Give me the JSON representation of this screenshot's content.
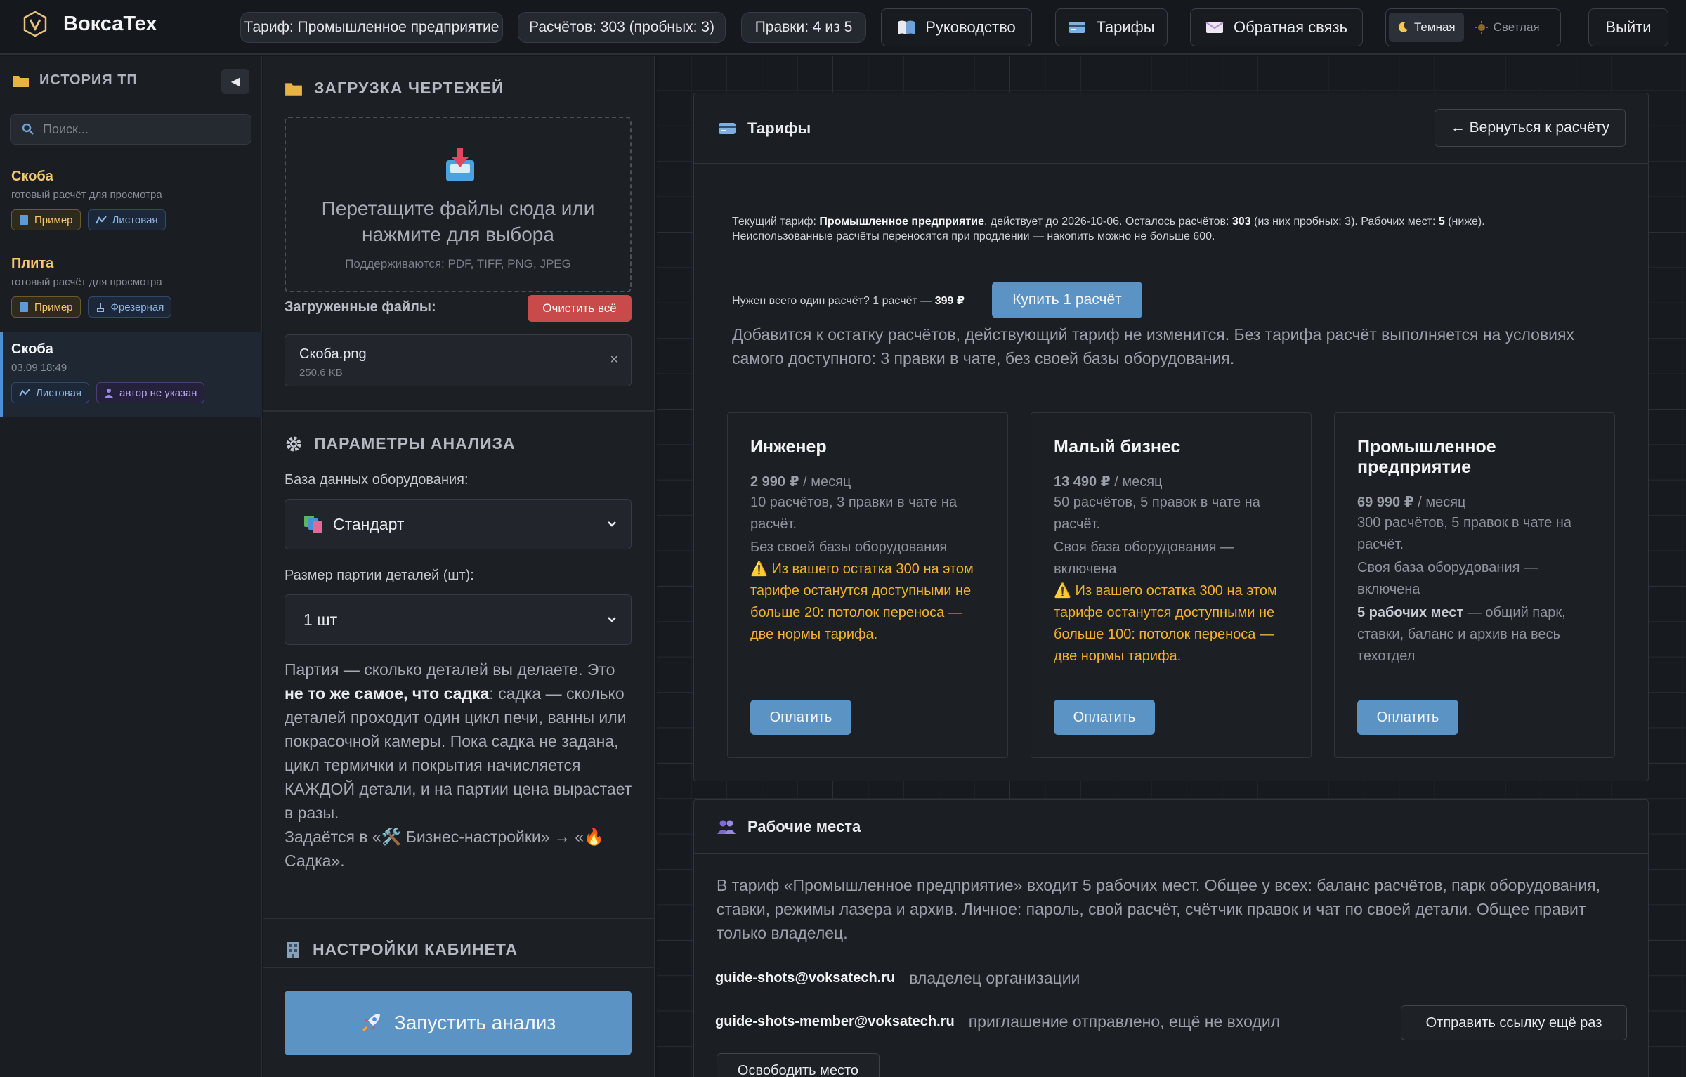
{
  "app": {
    "name": "ВоксаТех"
  },
  "topbar": {
    "tariff_pill": "Тариф: Промышленное предприятие",
    "calcs_pill": "Расчётов: 303 (пробных: 3)",
    "edits_pill": "Правки: 4 из 5",
    "guide_label": "Руководство",
    "tariffs_label": "Тарифы",
    "feedback_label": "Обратная связь",
    "theme_dark": "Темная",
    "theme_light": "Светлая",
    "logout_label": "Выйти"
  },
  "sidebar": {
    "title": "ИСТОРИЯ ТП",
    "collapse_glyph": "◀",
    "search_placeholder": "Поиск...",
    "items": [
      {
        "title": "Скоба",
        "subtitle": "готовый расчёт для просмотра",
        "tags": [
          "Пример",
          "Листовая"
        ]
      },
      {
        "title": "Плита",
        "subtitle": "готовый расчёт для просмотра",
        "tags": [
          "Пример",
          "Фрезерная"
        ]
      },
      {
        "title": "Скоба",
        "subtitle": "03.09 18:49",
        "tags": [
          "Листовая",
          "автор не указан"
        ]
      }
    ]
  },
  "upload": {
    "title": "ЗАГРУЗКА ЧЕРТЕЖЕЙ",
    "drop_line1": "Перетащите файлы сюда или",
    "drop_line2": "нажмите для выбора",
    "supported": "Поддерживаются: PDF, TIFF, PNG, JPEG",
    "uploaded_label": "Загруженные файлы:",
    "clear_all": "Очистить всё",
    "file_name": "Скоба.png",
    "file_size": "250.6 KB",
    "remove_glyph": "×"
  },
  "analysis": {
    "title": "ПАРАМЕТРЫ АНАЛИЗА",
    "db_label": "База данных оборудования:",
    "db_value": "Стандарт",
    "batch_label": "Размер партии деталей (шт):",
    "batch_value": "1 шт",
    "note_p1": "Партия — сколько деталей вы делаете. Это ",
    "note_bold": "не то же самое, что садка",
    "note_p2": ": садка — сколько деталей проходит один цикл печи, ванны или покрасочной камеры. Пока садка не задана, цикл термички и покрытия начисляется КАЖДОЙ детали, и на партии цена вырастает в разы.",
    "note_p3": "Задаётся в «🛠️ Бизнес-настройки» → «🔥 Садка».",
    "cabinet_title": "НАСТРОЙКИ КАБИНЕТА",
    "run_label": "Запустить анализ"
  },
  "tariffs": {
    "title": "Тарифы",
    "back_label": "← Вернуться к расчёту",
    "info_a": "Текущий тариф: ",
    "info_tariff": "Промышленное предприятие",
    "info_b": ", действует до 2026-10-06. Осталось расчётов: ",
    "info_calcs": "303",
    "info_c": " (из них пробных: 3). Рабочих мест: ",
    "info_seats": "5",
    "info_d": " (ниже).",
    "info_line2": "Неиспользованные расчёты переносятся при продлении — накопить можно не больше 600.",
    "single_a": "Нужен всего один расчёт? 1 расчёт — ",
    "single_price": "399 ₽",
    "buy_one": "Купить 1 расчёт",
    "single_note": "Добавится к остатку расчётов, действующий тариф не изменится. Без тарифа расчёт выполняется на условиях самого доступного: 3 правки в чате, без своей базы оборудования.",
    "plans": [
      {
        "name": "Инженер",
        "price": "2 990 ₽",
        "period": " / месяц",
        "line1": "10 расчётов, 3 правки в чате на расчёт.",
        "line2": "Без своей базы оборудования",
        "line3": "",
        "line3_rest": "",
        "warning": "⚠️ Из вашего остатка 300 на этом тарифе останутся доступными не больше 20: потолок переноса — две нормы тарифа.",
        "pay": "Оплатить"
      },
      {
        "name": "Малый бизнес",
        "price": "13 490 ₽",
        "period": " / месяц",
        "line1": "50 расчётов, 5 правок в чате на расчёт.",
        "line2": "Своя база оборудования — включена",
        "line3": "",
        "line3_rest": "",
        "warning": "⚠️ Из вашего остатка 300 на этом тарифе останутся доступными не больше 100: потолок переноса — две нормы тарифа.",
        "pay": "Оплатить"
      },
      {
        "name": "Промышленное предприятие",
        "price": "69 990 ₽",
        "period": " / месяц",
        "line1": "300 расчётов, 5 правок в чате на расчёт.",
        "line2": "Своя база оборудования — включена",
        "line3": "5 рабочих мест",
        "line3_rest": " — общий парк, ставки, баланс и архив на весь техотдел",
        "warning": "",
        "pay": "Оплатить"
      }
    ]
  },
  "workspaces": {
    "title": "Рабочие места",
    "desc": "В тариф «Промышленное предприятие» входит 5 рабочих мест. Общее у всех: баланс расчётов, парк оборудования, ставки, режимы лазера и архив. Личное: пароль, свой расчёт, счётчик правок и чат по своей детали. Общее правит только владелец.",
    "owner_email": "guide-shots@voksatech.ru",
    "owner_status": "владелец организации",
    "member_email": "guide-shots-member@voksatech.ru",
    "member_status": "приглашение отправлено, ещё не входил",
    "resend_label": "Отправить ссылку ещё раз",
    "release_label": "Освободить место"
  },
  "colors": {
    "accent": "#5b93c4",
    "danger": "#c94a4a",
    "warning": "#f2b22c",
    "gold": "#f0c770"
  }
}
